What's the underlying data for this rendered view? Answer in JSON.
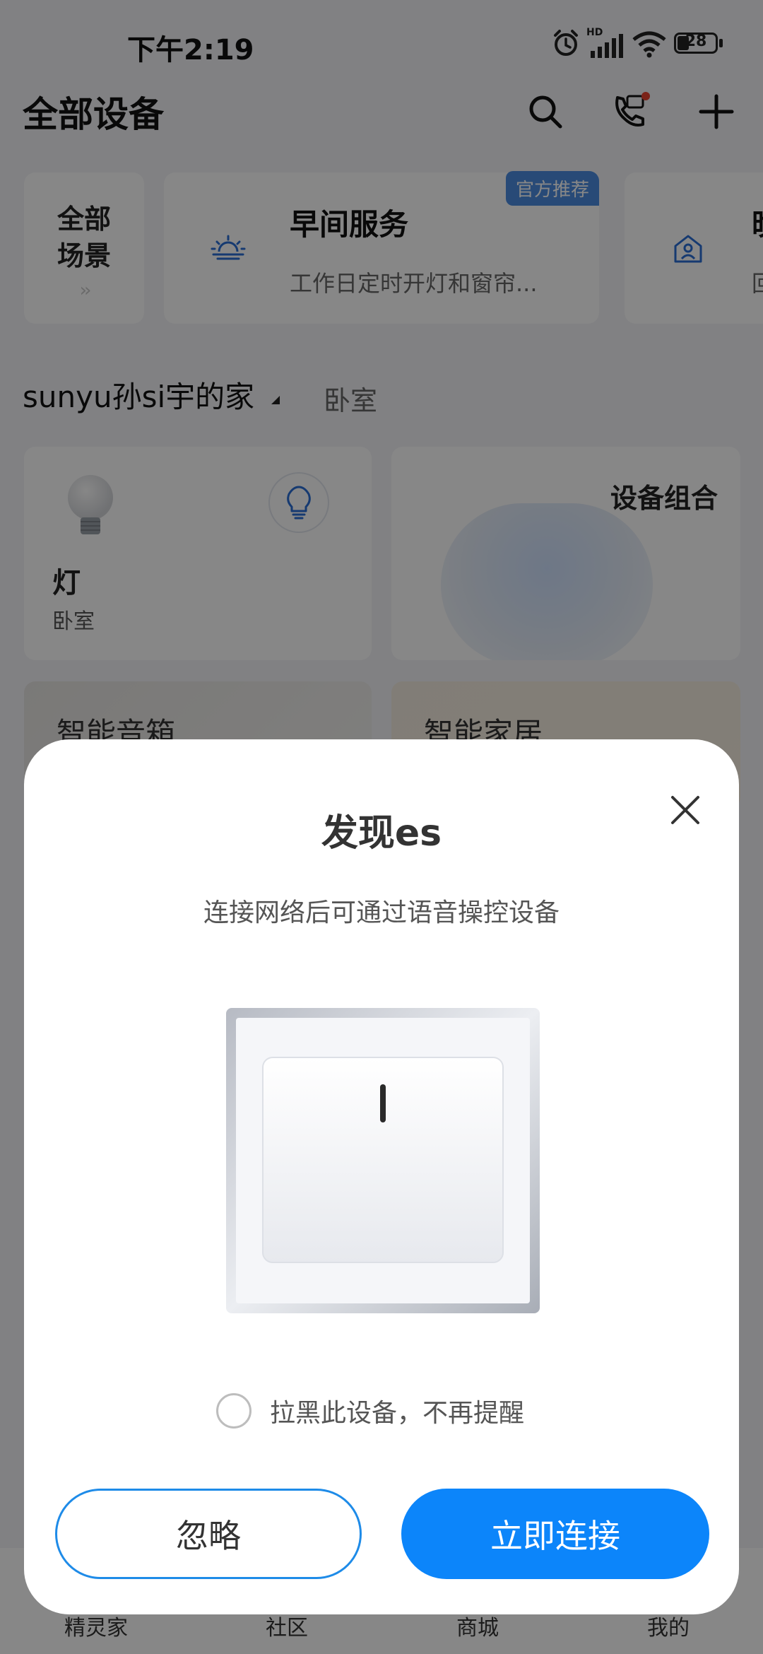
{
  "status_bar": {
    "time": "下午2:19",
    "battery": "28",
    "network": "HD"
  },
  "header": {
    "title": "全部设备"
  },
  "scenes": {
    "all_label_line1": "全部",
    "all_label_line2": "场景",
    "all_arrow": "››",
    "morning": {
      "title": "早间服务",
      "subtitle": "工作日定时开灯和窗帘...",
      "badge": "官方推荐"
    },
    "third": {
      "title": "晚",
      "subtitle": "回"
    }
  },
  "home": {
    "name": "sunyu孙si宇的家",
    "room_tab": "卧室"
  },
  "devices": {
    "lamp": {
      "name": "灯",
      "room": "卧室"
    },
    "group": {
      "title": "设备组合"
    },
    "speaker_promo": "智能音箱",
    "home_promo": "智能家居"
  },
  "bottom_nav": [
    "精灵家",
    "社区",
    "商城",
    "我的"
  ],
  "modal": {
    "title": "发现es",
    "subtitle": "连接网络后可通过语音操控设备",
    "blacklist_label": "拉黑此设备，不再提醒",
    "ignore_label": "忽略",
    "connect_label": "立即连接"
  },
  "colors": {
    "accent": "#0c85fa",
    "badge": "#4c8de0",
    "icon_blue": "#2a6fd6"
  }
}
